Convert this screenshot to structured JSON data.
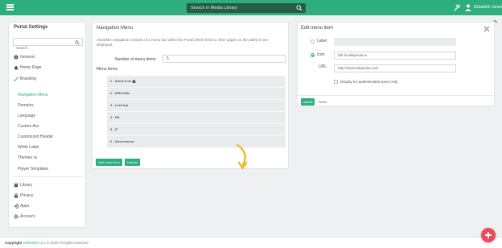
{
  "topbar": {
    "search_placeholder": "Search in Media Library",
    "user_name": "Elizabeth Jones"
  },
  "sidebar": {
    "title": "Portal Settings",
    "search_placeholder": "Search",
    "items": [
      {
        "label": "General",
        "icon": "info-circle-icon"
      },
      {
        "label": "Home Page",
        "icon": "home-icon"
      },
      {
        "label": "Branding",
        "icon": "brush-icon"
      }
    ],
    "branding_sub": [
      "Navigation Menu",
      "Domains",
      "Language",
      "Custom Ara",
      "Customized Header",
      "White Label",
      "Themes ra",
      "Player Templates"
    ],
    "bottom_items": [
      {
        "label": "Library",
        "icon": "book-icon"
      },
      {
        "label": "Privacy",
        "icon": "lock-icon"
      },
      {
        "label": "Apps",
        "icon": "sign-in-icon"
      },
      {
        "label": "Account",
        "icon": "gear-icon"
      }
    ]
  },
  "navigation_menu": {
    "title": "Navigation Menu",
    "description": "VIDIZMO navigation consists of a menu bar within the Portal where links to other pages on the platform are displayed.",
    "num_items_label": "Number of menu items",
    "num_items_value": "5",
    "menu_items_label": "Menu Items",
    "items": [
      "1 - Home Icon",
      "2 - AllPortals",
      "3 - LusCorp",
      "4 - HR",
      "5 - IT",
      "6 - Government"
    ],
    "add_button": "Add menu item",
    "update_button": "Update"
  },
  "edit_menu_item": {
    "title": "Edit menu item",
    "label_option": "Label",
    "icon_option": "Icon",
    "icon_value": "fab fa-wikipedia-w",
    "url_label": "URL",
    "url_value": "http://www.wikipedia.com",
    "display_checkbox": "Display for authenticated users only",
    "update_button": "Update",
    "reset_button": "Reset"
  },
  "footer": {
    "copyright_label": "Copyright",
    "brand": "VIDIZMO LLC",
    "rest": "© 2020 All rights reserved"
  },
  "colors": {
    "accent": "#2eae7e",
    "search_bg": "#255c48",
    "fab": "#ec4a5d",
    "arrow": "#f2b417"
  }
}
